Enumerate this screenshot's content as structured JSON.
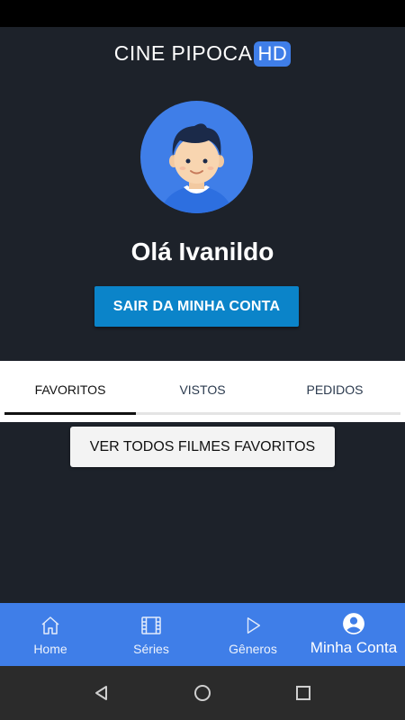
{
  "app": {
    "logo_text": "CINE PIPOCA",
    "logo_badge": "HD"
  },
  "profile": {
    "greeting": "Olá Ivanildo",
    "logout_label": "SAIR DA MINHA CONTA",
    "avatar_icon": "user-avatar-icon"
  },
  "tabs": {
    "items": [
      {
        "label": "FAVORITOS",
        "active": true
      },
      {
        "label": "VISTOS",
        "active": false
      },
      {
        "label": "PEDIDOS",
        "active": false
      }
    ]
  },
  "favorites": {
    "view_all_label": "VER TODOS FILMES FAVORITOS"
  },
  "bottom_nav": {
    "items": [
      {
        "label": "Home",
        "icon": "home-icon"
      },
      {
        "label": "Séries",
        "icon": "film-icon"
      },
      {
        "label": "Gêneros",
        "icon": "play-icon"
      },
      {
        "label": "Minha Conta",
        "icon": "account-icon",
        "active": true
      }
    ]
  },
  "colors": {
    "background": "#1d222a",
    "accent": "#3f7ee8",
    "button": "#0b84c9"
  }
}
